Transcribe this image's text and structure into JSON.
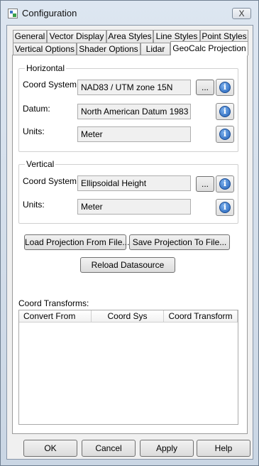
{
  "window": {
    "title": "Configuration",
    "close_symbol": "X"
  },
  "tabs": {
    "row1": [
      "General",
      "Vector Display",
      "Area Styles",
      "Line Styles",
      "Point Styles"
    ],
    "row2": [
      "Vertical Options",
      "Shader Options",
      "Lidar",
      "GeoCalc Projection"
    ],
    "active": "GeoCalc Projection"
  },
  "horizontal": {
    "title": "Horizontal",
    "coord_system_label": "Coord System:",
    "coord_system_value": "NAD83 / UTM zone 15N",
    "datum_label": "Datum:",
    "datum_value": "North American Datum 1983",
    "units_label": "Units:",
    "units_value": "Meter"
  },
  "vertical": {
    "title": "Vertical",
    "coord_system_label": "Coord System:",
    "coord_system_value": "Ellipsoidal Height",
    "units_label": "Units:",
    "units_value": "Meter"
  },
  "browse_label": "...",
  "info_symbol": "i",
  "buttons": {
    "load_projection": "Load Projection From File...",
    "save_projection": "Save Projection To File...",
    "reload_datasource": "Reload Datasource"
  },
  "coord_transforms": {
    "label": "Coord Transforms:",
    "columns": [
      "Convert From",
      "Coord Sys",
      "Coord Transform"
    ]
  },
  "footer": {
    "ok": "OK",
    "cancel": "Cancel",
    "apply": "Apply",
    "help": "Help"
  }
}
